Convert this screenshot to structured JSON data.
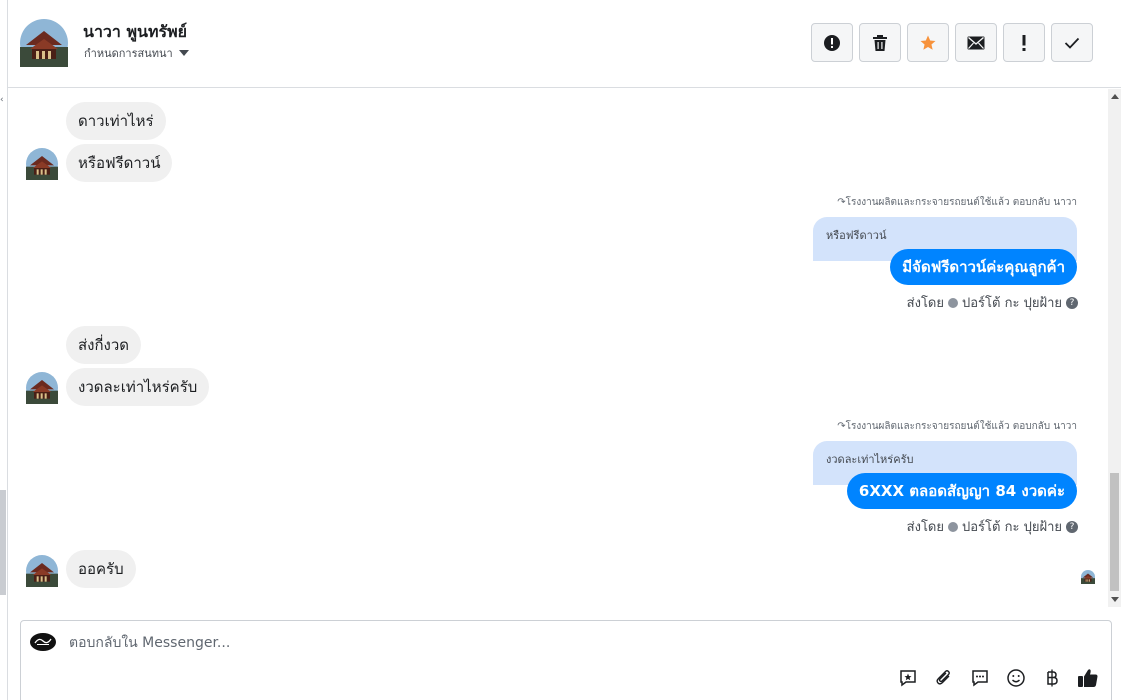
{
  "header": {
    "contact_name": "นาวา พูนทรัพย์",
    "assign_label": "กำหนดการสนทนา"
  },
  "toolbar": {
    "buttons": [
      {
        "name": "spam",
        "icon": "alert-circle-icon"
      },
      {
        "name": "delete",
        "icon": "trash-icon"
      },
      {
        "name": "star",
        "icon": "star-icon",
        "color": "#f7923b"
      },
      {
        "name": "mark-unread",
        "icon": "envelope-icon"
      },
      {
        "name": "follow-up",
        "icon": "exclamation-icon"
      },
      {
        "name": "done",
        "icon": "checkmark-icon"
      }
    ]
  },
  "messages": {
    "in_1": "ดาวเท่าไหร่",
    "in_2": "หรือฟรีดาวน์",
    "reply_1_meta": "โรงงานผลิตและกระจายรถยนต์ใช้แล้ว ตอบกลับ นาวา",
    "reply_1_quoted": "หรือฟรีดาวน์",
    "reply_1_text": "มีจัดฟรีดาวน์ค่ะคุณลูกค้า",
    "reply_1_sent_by_prefix": "ส่งโดย",
    "reply_1_sent_by_name": "ปอร์โต้ กะ ปุยฝ้าย",
    "in_3": "ส่งกี่งวด",
    "in_4": "งวดละเท่าไหร่ครับ",
    "reply_2_meta": "โรงงานผลิตและกระจายรถยนต์ใช้แล้ว ตอบกลับ นาวา",
    "reply_2_quoted": "งวดละเท่าไหร่ครับ",
    "reply_2_text": "6XXX ตลอดสัญญา 84 งวดค่ะ",
    "reply_2_sent_by_prefix": "ส่งโดย",
    "reply_2_sent_by_name": "ปอร์โต้ กะ ปุยฝ้าย",
    "in_5": "ออครับ"
  },
  "composer": {
    "placeholder": "ตอบกลับใน Messenger...",
    "tools": [
      "saved-reply-icon",
      "attachment-icon",
      "chat-bubble-icon",
      "emoji-icon",
      "baht-icon",
      "thumbs-up-icon"
    ]
  },
  "colors": {
    "outgoing_bubble": "#0084ff",
    "quoted_bubble": "#d3e3fb",
    "incoming_bubble": "#f0f0f0",
    "star": "#f7923b",
    "like": "#1c1e21"
  }
}
